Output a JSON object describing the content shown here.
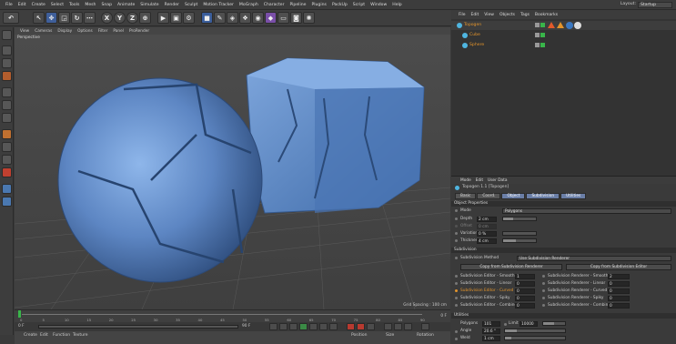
{
  "menubar": {
    "items": [
      "File",
      "Edit",
      "Create",
      "Select",
      "Tools",
      "Mesh",
      "Snap",
      "Animate",
      "Simulate",
      "Render",
      "Sculpt",
      "Motion Tracker",
      "MoGraph",
      "Character",
      "Pipeline",
      "Plugins",
      "PackUp",
      "Script",
      "Window",
      "Help"
    ],
    "layout_label": "Layout:",
    "layout_value": "Startup"
  },
  "toolbar": {
    "axis_x": "X",
    "axis_y": "Y",
    "axis_z": "Z"
  },
  "viewport": {
    "menu": [
      "View",
      "Cameras",
      "Display",
      "Options",
      "Filter",
      "Panel",
      "ProRender"
    ],
    "camera_label": "Perspective",
    "grid_spacing": "Grid Spacing : 100 cm"
  },
  "timeline": {
    "ticks": [
      "0",
      "5",
      "10",
      "15",
      "20",
      "25",
      "30",
      "35",
      "40",
      "45",
      "50",
      "55",
      "60",
      "65",
      "70",
      "75",
      "80",
      "85",
      "90"
    ],
    "current_frame": "0 F",
    "start_frame": "0 F",
    "end_frame": "90 F"
  },
  "bottom_menu": {
    "items": [
      "Create",
      "Edit",
      "Function",
      "Texture"
    ],
    "coord_labels": [
      "Position",
      "Size",
      "Rotation"
    ]
  },
  "object_manager": {
    "menu": [
      "File",
      "Edit",
      "View",
      "Objects",
      "Tags",
      "Bookmarks"
    ],
    "objects": [
      {
        "name": "Topogen",
        "icon_color": "#4fb5e0",
        "selected": true
      },
      {
        "name": "Cube",
        "icon_color": "#4fb5e0",
        "selected": false
      },
      {
        "name": "Sphere",
        "icon_color": "#4fb5e0",
        "selected": false
      }
    ]
  },
  "attribute_manager": {
    "menu": [
      "Mode",
      "Edit",
      "User Data"
    ],
    "title": "Topogen 1.1 [Topogen]",
    "tabs": [
      "Basic",
      "Coord.",
      "Object",
      "Subdivision",
      "Utilities"
    ],
    "active_tab": "Object",
    "sections": {
      "object_properties": "Object Properties",
      "subdivision": "Subdivision",
      "utilities": "Utilities"
    },
    "props": {
      "mode_label": "Mode",
      "mode_value": "Polygons",
      "depth_label": "Depth",
      "depth_value": "2 cm",
      "offset_label": "Offset",
      "offset_value": "0 cm",
      "variation_label": "Variation",
      "variation_value": "0 %",
      "thickness_label": "Thickness",
      "thickness_value": "4 cm"
    },
    "subdivision": {
      "method_label": "Subdivision Method",
      "method_value": "Use Subdivision Renderer",
      "copy_from_btn": "Copy from Subdivision Renderer",
      "copy_to_btn": "Copy from Subdivision Editor",
      "left_rows": [
        {
          "label": "Subdivision Editor - Smooth",
          "value": "1"
        },
        {
          "label": "Subdivision Editor - Linear",
          "value": "0"
        },
        {
          "label": "Subdivision Editor - Curved",
          "value": "0"
        },
        {
          "label": "Subdivision Editor - Spiky",
          "value": "0"
        },
        {
          "label": "Subdivision Editor - Combined",
          "value": "0"
        }
      ],
      "right_rows": [
        {
          "label": "Subdivision Renderer - Smooth",
          "value": "2"
        },
        {
          "label": "Subdivision Renderer - Linear",
          "value": "0"
        },
        {
          "label": "Subdivision Renderer - Curved",
          "value": "0"
        },
        {
          "label": "Subdivision Renderer - Spiky",
          "value": "0"
        },
        {
          "label": "Subdivision Renderer - Combined",
          "value": "0"
        }
      ]
    },
    "utilities": {
      "polygons_label": "Polygons",
      "polygons_value": "101",
      "limit_label": "Limit",
      "limit_value": "10000",
      "angle_label": "Angle",
      "angle_value": "20.6 °",
      "weld_label": "Weld",
      "weld_value": "1 cm"
    }
  },
  "colors": {
    "accent_blue": "#6a7ea6",
    "object_blue": "#5e86c2",
    "highlight_orange": "#e3942b"
  }
}
